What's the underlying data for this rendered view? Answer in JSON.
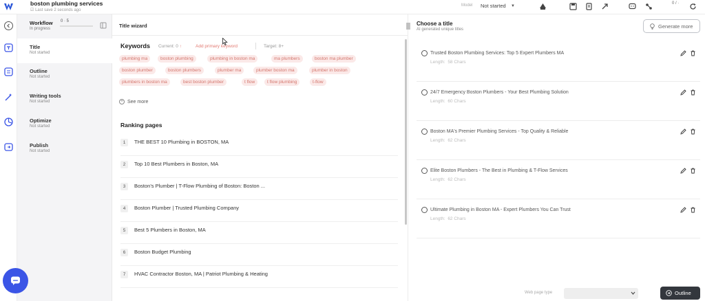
{
  "header": {
    "doc_title": "boston plumbing services",
    "save_status": "Last save",
    "save_time": "2 seconds ago",
    "model_label": "Model",
    "model_value": "Not started",
    "word_count": "0 / ·",
    "icons": [
      "cloud-icon",
      "save-icon",
      "export-icon",
      "share-icon",
      "chat-icon",
      "connect-icon",
      "refresh-icon"
    ]
  },
  "workflow": {
    "title": "Workflow",
    "status": "In progress",
    "count": "0 · 5",
    "items": [
      {
        "label": "Title",
        "status": "Not started",
        "active": true
      },
      {
        "label": "Outline",
        "status": "Not started",
        "active": false
      },
      {
        "label": "Writing tools",
        "status": "Not started",
        "active": false
      },
      {
        "label": "Optimize",
        "status": "Not started",
        "active": false
      },
      {
        "label": "Publish",
        "status": "Not started",
        "active": false
      }
    ]
  },
  "wizard": {
    "title": "Title wizard",
    "keywords": {
      "heading": "Keywords",
      "current": "Current: 0",
      "add_label": "Add primary keyword",
      "target": "Target: 8+",
      "chips": [
        "plumbing ma",
        "boston plumbing",
        "plumbing in boston ma",
        "ma plumbers",
        "boston ma plumber",
        "boston plumber",
        "boston plumbers",
        "plumber ma",
        "plumber boston ma",
        "plumber in boston",
        "plumbers in boston ma",
        "best boston plumber",
        "t flow",
        "t flow plumbing",
        "t-flow"
      ],
      "see_more": "See more"
    },
    "ranking": {
      "heading": "Ranking pages",
      "pages": [
        {
          "num": "1",
          "text": "THE BEST 10 Plumbing in BOSTON, MA"
        },
        {
          "num": "2",
          "text": "Top 10 Best Plumbers in Boston, MA"
        },
        {
          "num": "3",
          "text": "Boston's Plumber | T-Flow Plumbing of Boston: Boston ..."
        },
        {
          "num": "4",
          "text": "Boston Plumber | Trusted Plumbing Company"
        },
        {
          "num": "5",
          "text": "Best 5 Plumbers in Boston, MA"
        },
        {
          "num": "6",
          "text": "Boston Budget Plumbing"
        },
        {
          "num": "7",
          "text": "HVAC Contractor Boston, MA | Patriot Plumbing & Heating"
        }
      ]
    }
  },
  "titles": {
    "heading": "Choose a title",
    "subheading": "AI generated unique titles",
    "generate_label": "Generate more",
    "items": [
      {
        "text": "Trusted Boston Plumbing Services: Top 5 Expert Plumbers MA",
        "length_label": "Length:",
        "length_value": "58 Chars"
      },
      {
        "text": "24/7 Emergency Boston Plumbers - Your Best Plumbing Solution",
        "length_label": "Length:",
        "length_value": "60 Chars"
      },
      {
        "text": "Boston MA's Premier Plumbing Services - Top Quality & Reliable",
        "length_label": "Length:",
        "length_value": "62 Chars"
      },
      {
        "text": "Elite Boston Plumbers - The Best in Plumbing & T-Flow Services",
        "length_label": "Length:",
        "length_value": "62 Chars"
      },
      {
        "text": "Ultimate Plumbing in Boston MA - Expert Plumbers You Can Trust",
        "length_label": "Length:",
        "length_value": "62 Chars"
      }
    ]
  },
  "footer": {
    "web_page_type_label": "Web page type",
    "outline_label": "Outline"
  },
  "colors": {
    "accent_blue": "#3b55e6",
    "chip_bg": "#fbe9e8",
    "chip_text": "#d3756c",
    "dark_button": "#33373d"
  }
}
